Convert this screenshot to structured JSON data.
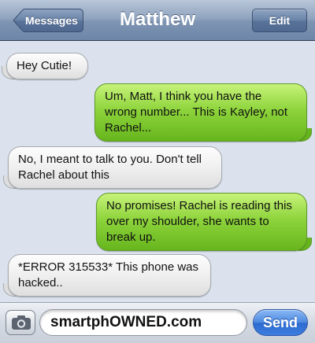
{
  "header": {
    "title": "Matthew",
    "back_label": "Messages",
    "edit_label": "Edit"
  },
  "messages": [
    {
      "direction": "incoming",
      "text": "Hey Cutie!"
    },
    {
      "direction": "outgoing",
      "text": "Um, Matt, I think you have the wrong number... This is Kayley, not Rachel..."
    },
    {
      "direction": "incoming",
      "text": "No, I meant to talk to you. Don't tell Rachel about this"
    },
    {
      "direction": "outgoing",
      "text": "No promises! Rachel is reading this over my shoulder, she wants to break up."
    },
    {
      "direction": "incoming",
      "text": "*ERROR 315533* This phone was hacked.."
    }
  ],
  "composer": {
    "input_value": "smartphOWNED.com",
    "send_label": "Send",
    "camera_icon": "camera-icon"
  },
  "colors": {
    "navbar": "#7f95b3",
    "outgoing_bubble": "#8ed43c",
    "incoming_bubble": "#eeeeee",
    "send_button": "#3d7ee0",
    "background": "#dbe2ed"
  }
}
